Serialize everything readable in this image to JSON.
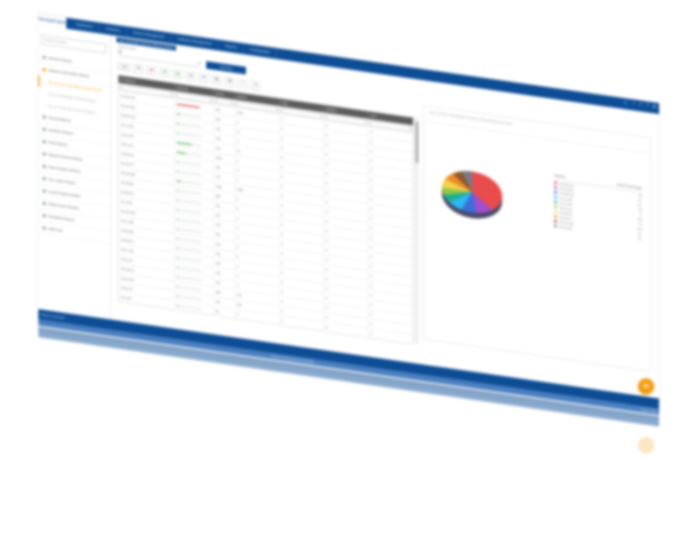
{
  "app": {
    "logo": "ManageEngine"
  },
  "top_nav": [
    "Dashboard",
    "Inventory",
    "Device Management",
    "Software Management",
    "Reports",
    "Configuration"
  ],
  "top_icons": [
    "user-icon",
    "search-icon",
    "bell-icon",
    "help-icon",
    "settings-icon"
  ],
  "sidebar": {
    "search_placeholder": "Search reports",
    "items": [
      {
        "label": "Standard Reports",
        "active": false
      },
      {
        "label": "Software Vulnerability Reports",
        "active": true
      },
      {
        "label": "Security Reports",
        "active": false
      },
      {
        "label": "Hardware Reports",
        "active": false
      },
      {
        "label": "Patch Reports",
        "active": false
      },
      {
        "label": "Network Devices Reports",
        "active": false
      },
      {
        "label": "Asset Analytics Reports",
        "active": false
      },
      {
        "label": "User Logon Reports",
        "active": false
      },
      {
        "label": "Custom Reports Builder",
        "active": false
      },
      {
        "label": "Mobile Device Reports",
        "active": false
      },
      {
        "label": "Scheduled Reports",
        "active": false
      },
      {
        "label": "Audit Logs",
        "active": false
      }
    ],
    "sub_items": [
      {
        "label": "Top 10 Most Vulnerable Devices Report",
        "active": true
      },
      {
        "label": "Top 10 Vulnerable Software Report",
        "active": false
      },
      {
        "label": "Top 10 Vulnerable Versions Report",
        "active": false
      }
    ]
  },
  "main": {
    "title": "Top Vulnerable Devices Affected Report",
    "filter_label": "Select Group",
    "filter_value": "All",
    "generate_button": "Generate",
    "per_page": "100",
    "toolbar_icons": [
      "refresh-icon",
      "pdf-icon",
      "excel-icon",
      "csv-icon",
      "print-icon",
      "email-icon",
      "settings-icon",
      "filter-icon",
      "add-icon",
      "export-icon"
    ]
  },
  "grid": {
    "columns": [
      "IP Address",
      "Severity",
      "Count",
      "Critical",
      "High",
      "Medium",
      "Low"
    ],
    "rows": [
      {
        "ip": "10.0.26.134",
        "pct": 0.9,
        "bar_color": "#d9534f",
        "count": "820",
        "critical": "2310",
        "high": "4",
        "medium": "0",
        "low": "0"
      },
      {
        "ip": "10.0.18.202",
        "pct": 0.1,
        "bar_color": "#5cb85c",
        "count": "302",
        "critical": "4",
        "high": "0",
        "medium": "0",
        "low": "0"
      },
      {
        "ip": "10.0.50.120",
        "pct": 0.08,
        "bar_color": "#5cb85c",
        "count": "166",
        "critical": "11",
        "high": "0",
        "medium": "0",
        "low": "0"
      },
      {
        "ip": "10.1.21.08",
        "pct": 0.05,
        "bar_color": "#5cb85c",
        "count": "148",
        "critical": "0",
        "high": "0",
        "medium": "0",
        "low": "0"
      },
      {
        "ip": "10.0.22.45",
        "pct": 0.6,
        "bar_color": "#5cb85c",
        "count": "143",
        "critical": "16",
        "high": "0",
        "medium": "0",
        "low": "0"
      },
      {
        "ip": "10.0.14.22",
        "pct": 0.35,
        "bar_color": "#5cb85c",
        "count": "1018",
        "critical": "3",
        "high": "0",
        "medium": "0",
        "low": "0"
      },
      {
        "ip": "10.0.60.18",
        "pct": 0.05,
        "bar_color": "#5cb85c",
        "count": "780",
        "critical": "0",
        "high": "0",
        "medium": "0",
        "low": "0"
      },
      {
        "ip": "10.0.20.72",
        "pct": 0.05,
        "bar_color": "#5cb85c",
        "count": "270",
        "critical": "2",
        "high": "0",
        "medium": "0",
        "low": "0"
      },
      {
        "ip": "10.0.40.180",
        "pct": 0.15,
        "bar_color": "#5cb85c",
        "count": "1034",
        "critical": "1040",
        "high": "0",
        "medium": "0",
        "low": "0"
      },
      {
        "ip": "10.0.35.09",
        "pct": 0.05,
        "bar_color": "#5cb85c",
        "count": "960",
        "critical": "0",
        "high": "0",
        "medium": "0",
        "low": "0"
      },
      {
        "ip": "10.0.48.22",
        "pct": 0.05,
        "bar_color": "#5cb85c",
        "count": "231",
        "critical": "0",
        "high": "0",
        "medium": "0",
        "low": "0"
      },
      {
        "ip": "10.1.3.80",
        "pct": 0.05,
        "bar_color": "#5cb85c",
        "count": "197",
        "critical": "0",
        "high": "0",
        "medium": "0",
        "low": "0"
      },
      {
        "ip": "10.0.12.200",
        "pct": 0.05,
        "bar_color": "#5cb85c",
        "count": "157",
        "critical": "0",
        "high": "0",
        "medium": "0",
        "low": "0"
      },
      {
        "ip": "10.0.1.180",
        "pct": 0.05,
        "bar_color": "#5cb85c",
        "count": "150",
        "critical": "0",
        "high": "0",
        "medium": "0",
        "low": "0"
      },
      {
        "ip": "10.0.62.50",
        "pct": 0.05,
        "bar_color": "#5cb85c",
        "count": "144",
        "critical": "0",
        "high": "0",
        "medium": "0",
        "low": "0"
      },
      {
        "ip": "10.0.55.12",
        "pct": 0.05,
        "bar_color": "#5cb85c",
        "count": "139",
        "critical": "0",
        "high": "0",
        "medium": "0",
        "low": "0"
      },
      {
        "ip": "10.0.7.104",
        "pct": 0.05,
        "bar_color": "#5cb85c",
        "count": "136",
        "critical": "0",
        "high": "0",
        "medium": "0",
        "low": "0"
      },
      {
        "ip": "10.0.4.18",
        "pct": 0.05,
        "bar_color": "#5cb85c",
        "count": "128",
        "critical": "0",
        "high": "0",
        "medium": "0",
        "low": "0"
      },
      {
        "ip": "10.0.39.19",
        "pct": 0.05,
        "bar_color": "#5cb85c",
        "count": "120",
        "critical": "0",
        "high": "0",
        "medium": "0",
        "low": "0"
      },
      {
        "ip": "10.0.41.60",
        "pct": 0.05,
        "bar_color": "#5cb85c",
        "count": "108",
        "critical": "144",
        "high": "0",
        "medium": "0",
        "low": "0"
      },
      {
        "ip": "10.0.9.33",
        "pct": 0.05,
        "bar_color": "#5cb85c",
        "count": "105",
        "critical": "206",
        "high": "0",
        "medium": "0",
        "low": "0"
      },
      {
        "ip": "10.0.28.7",
        "pct": 0.05,
        "bar_color": "#5cb85c",
        "count": "99",
        "critical": "0",
        "high": "0",
        "medium": "0",
        "low": "0"
      },
      {
        "ip": "10.0.44.81",
        "pct": 0.05,
        "bar_color": "#5cb85c",
        "count": "96",
        "critical": "0",
        "high": "0",
        "medium": "0",
        "low": "0"
      }
    ]
  },
  "chart_data": {
    "type": "pie",
    "title": "Top 10 Most Vulnerable Devices Affected Report Chart",
    "legend_header": [
      "Address",
      "Virtual Percentage"
    ],
    "categories": [
      "10.0.26.134",
      "10.0.18.202",
      "10.0.50.120",
      "10.1.21.08",
      "10.0.22.45",
      "10.0.14.22",
      "10.0.60.18",
      "10.0.20.72",
      "10.0.40.180",
      "10.0.35.09"
    ],
    "values": [
      38.0,
      9.7,
      8.1,
      7.8,
      6.0,
      5.5,
      7.4,
      6.3,
      6.1,
      5.1
    ],
    "colors": [
      "#e84c4c",
      "#a04fd0",
      "#3a6fd8",
      "#2db7f5",
      "#20b090",
      "#93c846",
      "#f1d24b",
      "#f08a24",
      "#8c5a2e",
      "#7a7a8a"
    ]
  },
  "status": {
    "left": "Report Generator",
    "middle": "Server Connected Successfully",
    "right": "Quick Help"
  },
  "fab": {
    "icon": "chat-icon"
  }
}
